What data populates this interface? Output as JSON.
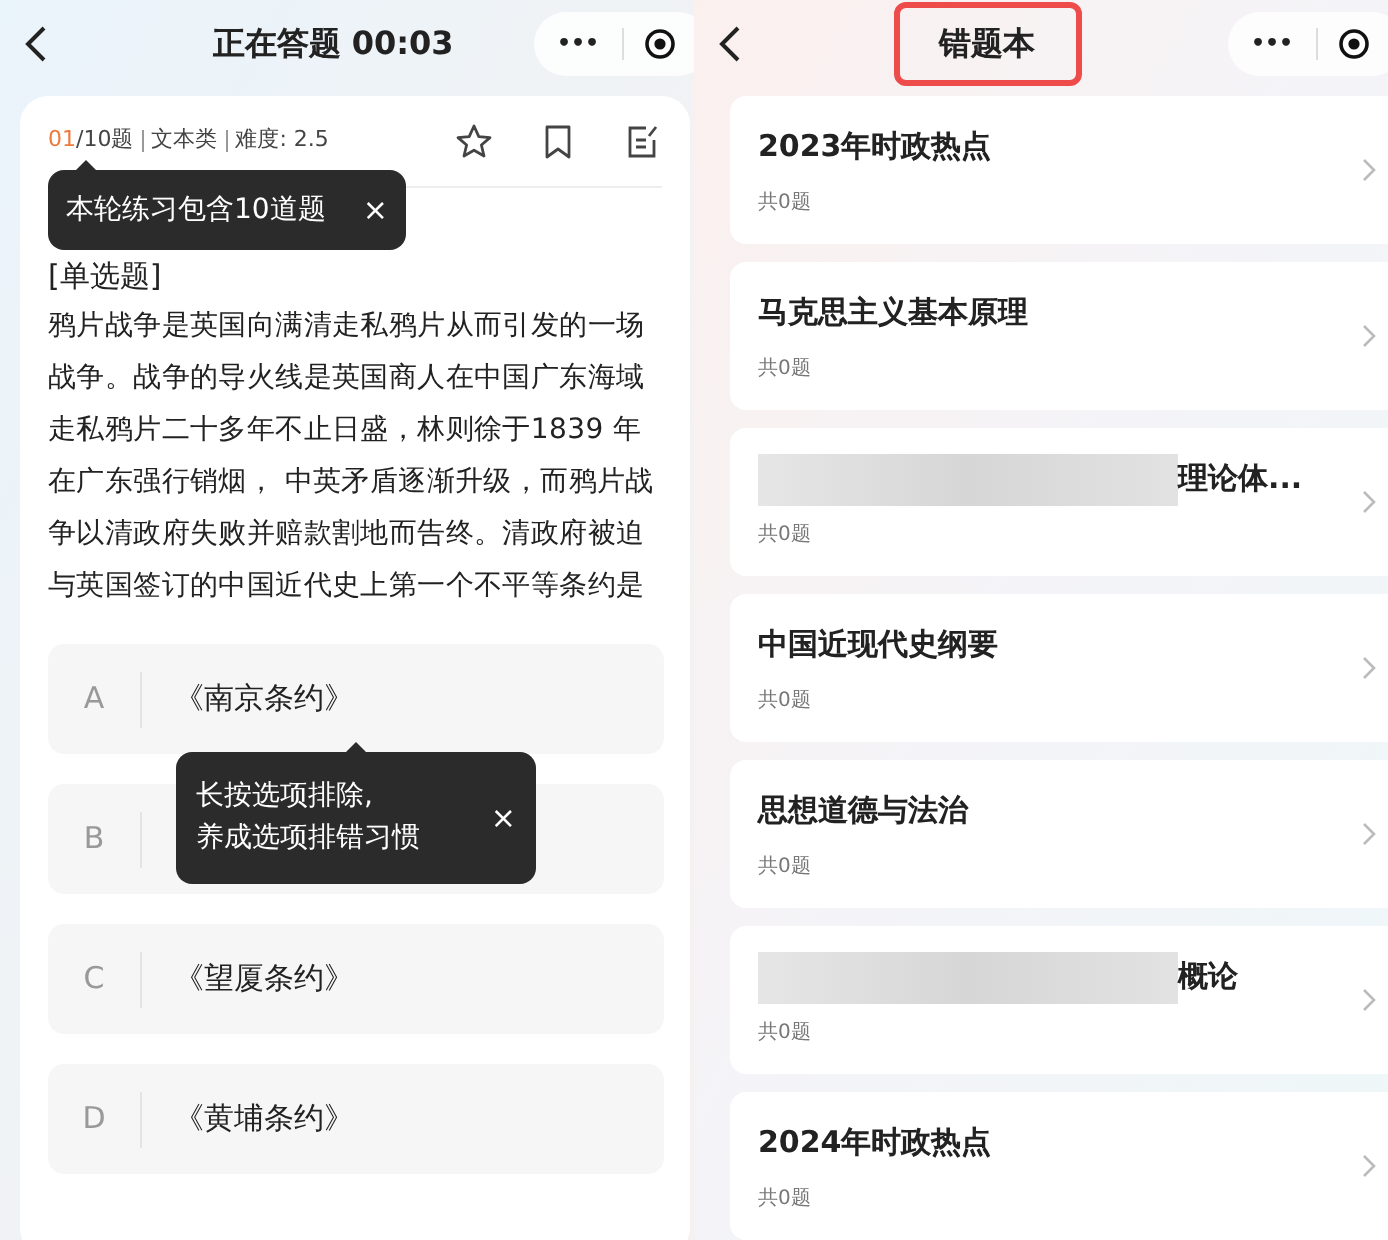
{
  "quiz_screen": {
    "header": {
      "title": "正在答题 00:03",
      "more": "•••"
    },
    "meta": {
      "current": "01",
      "total": "/10题",
      "type": "文本类",
      "difficulty": "难度: 2.5"
    },
    "tip_top": {
      "text": "本轮练习包含10道题",
      "close": "×"
    },
    "question_type": "[单选题]",
    "question": "鸦片战争是英国向满清走私鸦片从而引发的一场战争。战争的导火线是英国商人在中国广东海域走私鸦片二十多年不止日盛，林则徐于1839 年在广东强行销烟， 中英矛盾逐渐升级，而鸦片战争以清政府失败并赔款割地而告终。清政府被迫与英国签订的中国近代史上第一个不平等条约是",
    "options": [
      {
        "letter": "A",
        "text": "《南京条约》"
      },
      {
        "letter": "B"
      },
      {
        "letter": "C",
        "text": "《望厦条约》"
      },
      {
        "letter": "D",
        "text": "《黄埔条约》"
      }
    ],
    "tip_options": {
      "lines": [
        "长按选项排除,",
        "养成选项排错习惯"
      ],
      "close": "×"
    }
  },
  "wrong_book_screen": {
    "header": {
      "title": "错题本",
      "highlighted": true,
      "more": "•••"
    },
    "items": [
      {
        "title": "2023年时政热点",
        "count": "共0题",
        "redacted": false
      },
      {
        "title": "马克思主义基本原理",
        "count": "共0题",
        "redacted": false
      },
      {
        "title": "理论体...",
        "count": "共0题",
        "redacted": true
      },
      {
        "title": "中国近现代史纲要",
        "count": "共0题",
        "redacted": false
      },
      {
        "title": "思想道德与法治",
        "count": "共0题",
        "redacted": false
      },
      {
        "title": "概论",
        "count": "共0题",
        "redacted": true
      },
      {
        "title": "2024年时政热点",
        "count": "共0题",
        "redacted": false
      }
    ]
  }
}
